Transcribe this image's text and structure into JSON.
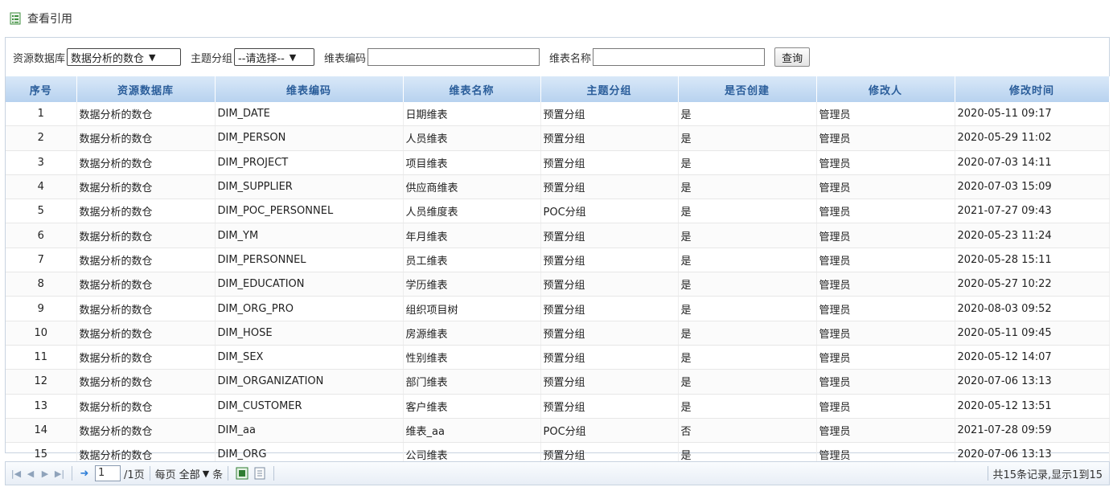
{
  "page": {
    "title": "查看引用"
  },
  "filters": {
    "source_db_label": "资源数据库",
    "source_db_value": "数据分析的数仓",
    "subject_group_label": "主题分组",
    "subject_group_value": "--请选择--",
    "table_code_label": "维表编码",
    "table_code_value": "",
    "table_name_label": "维表名称",
    "table_name_value": "",
    "query_label": "查询"
  },
  "table": {
    "columns": [
      "序号",
      "资源数据库",
      "维表编码",
      "维表名称",
      "主题分组",
      "是否创建",
      "修改人",
      "修改时间"
    ],
    "rows": [
      [
        "1",
        "数据分析的数仓",
        "DIM_DATE",
        "日期维表",
        "预置分组",
        "是",
        "管理员",
        "2020-05-11 09:17"
      ],
      [
        "2",
        "数据分析的数仓",
        "DIM_PERSON",
        "人员维表",
        "预置分组",
        "是",
        "管理员",
        "2020-05-29 11:02"
      ],
      [
        "3",
        "数据分析的数仓",
        "DIM_PROJECT",
        "项目维表",
        "预置分组",
        "是",
        "管理员",
        "2020-07-03 14:11"
      ],
      [
        "4",
        "数据分析的数仓",
        "DIM_SUPPLIER",
        "供应商维表",
        "预置分组",
        "是",
        "管理员",
        "2020-07-03 15:09"
      ],
      [
        "5",
        "数据分析的数仓",
        "DIM_POC_PERSONNEL",
        "人员维度表",
        "POC分组",
        "是",
        "管理员",
        "2021-07-27 09:43"
      ],
      [
        "6",
        "数据分析的数仓",
        "DIM_YM",
        "年月维表",
        "预置分组",
        "是",
        "管理员",
        "2020-05-23 11:24"
      ],
      [
        "7",
        "数据分析的数仓",
        "DIM_PERSONNEL",
        "员工维表",
        "预置分组",
        "是",
        "管理员",
        "2020-05-28 15:11"
      ],
      [
        "8",
        "数据分析的数仓",
        "DIM_EDUCATION",
        "学历维表",
        "预置分组",
        "是",
        "管理员",
        "2020-05-27 10:22"
      ],
      [
        "9",
        "数据分析的数仓",
        "DIM_ORG_PRO",
        "组织项目树",
        "预置分组",
        "是",
        "管理员",
        "2020-08-03 09:52"
      ],
      [
        "10",
        "数据分析的数仓",
        "DIM_HOSE",
        "房源维表",
        "预置分组",
        "是",
        "管理员",
        "2020-05-11 09:45"
      ],
      [
        "11",
        "数据分析的数仓",
        "DIM_SEX",
        "性别维表",
        "预置分组",
        "是",
        "管理员",
        "2020-05-12 14:07"
      ],
      [
        "12",
        "数据分析的数仓",
        "DIM_ORGANIZATION",
        "部门维表",
        "预置分组",
        "是",
        "管理员",
        "2020-07-06 13:13"
      ],
      [
        "13",
        "数据分析的数仓",
        "DIM_CUSTOMER",
        "客户维表",
        "预置分组",
        "是",
        "管理员",
        "2020-05-12 13:51"
      ],
      [
        "14",
        "数据分析的数仓",
        "DIM_aa",
        "维表_aa",
        "POC分组",
        "否",
        "管理员",
        "2021-07-28 09:59"
      ],
      [
        "15",
        "数据分析的数仓",
        "DIM_ORG",
        "公司维表",
        "预置分组",
        "是",
        "管理员",
        "2020-07-06 13:13"
      ]
    ]
  },
  "pager": {
    "current_page": "1",
    "total_pages_label": "/1页",
    "per_page_label": "每页",
    "per_page_value": "全部",
    "per_page_unit": "条",
    "summary": "共15条记录,显示1到15"
  },
  "icons": {
    "title_icon": "list-document-icon",
    "first": "first-page-icon",
    "prev": "prev-page-icon",
    "next": "next-page-icon",
    "last": "last-page-icon",
    "go": "go-arrow-icon",
    "export_excel": "excel-export-icon",
    "export_doc": "document-export-icon"
  }
}
